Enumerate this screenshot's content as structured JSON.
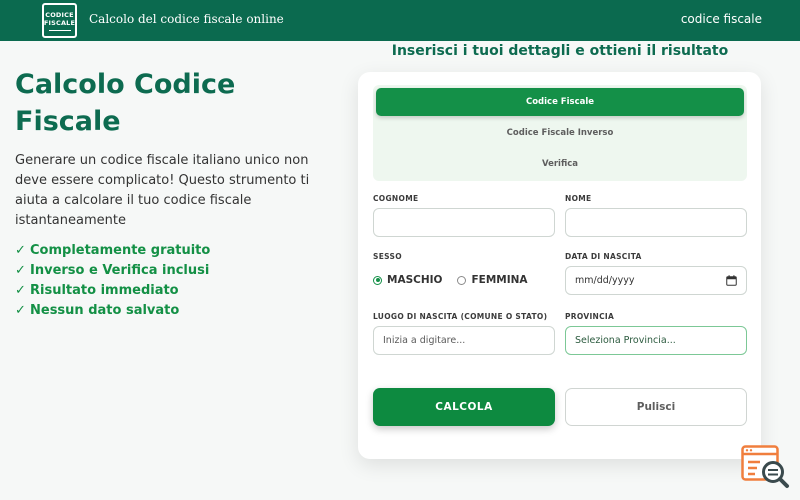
{
  "header": {
    "logo_line1": "CODICE",
    "logo_line2": "FISCALE",
    "site_title": "Calcolo del codice fiscale online",
    "nav_link": "codice fiscale"
  },
  "hero": {
    "title": "Calcolo Codice Fiscale",
    "description": "Generare un codice fiscale italiano unico non deve essere complicato! Questo strumento ti aiuta a calcolare il tuo codice fiscale istantaneamente",
    "check_glyph": "✓",
    "features": [
      "Completamente gratuito",
      "Inverso e Verifica inclusi",
      "Risultato immediato",
      "Nessun dato salvato"
    ]
  },
  "form": {
    "heading": "Inserisci i tuoi dettagli e ottieni il risultato",
    "tabs": [
      {
        "label": "Codice Fiscale",
        "active": true
      },
      {
        "label": "Codice Fiscale Inverso",
        "active": false
      },
      {
        "label": "Verifica",
        "active": false
      }
    ],
    "fields": {
      "cognome_label": "COGNOME",
      "nome_label": "NOME",
      "sesso_label": "SESSO",
      "data_label": "DATA DI NASCITA",
      "data_placeholder": "mm/dd/yyyy",
      "luogo_label": "LUOGO DI NASCITA (COMUNE O STATO)",
      "luogo_placeholder": "Inizia a digitare...",
      "provincia_label": "PROVINCIA",
      "provincia_value": "Seleziona Provincia..."
    },
    "sesso_options": [
      {
        "label": "MASCHIO",
        "checked": true
      },
      {
        "label": "FEMMINA",
        "checked": false
      }
    ],
    "buttons": {
      "calcola": "CALCOLA",
      "pulisci": "Pulisci"
    }
  },
  "colors": {
    "header_bg": "#0b6a4f",
    "brand_green": "#149048",
    "title_green": "#0d6b50",
    "corner_icon": "#f07e3d"
  },
  "icons": {
    "date_field": "calendar-icon",
    "corner": "search-document-icon"
  }
}
